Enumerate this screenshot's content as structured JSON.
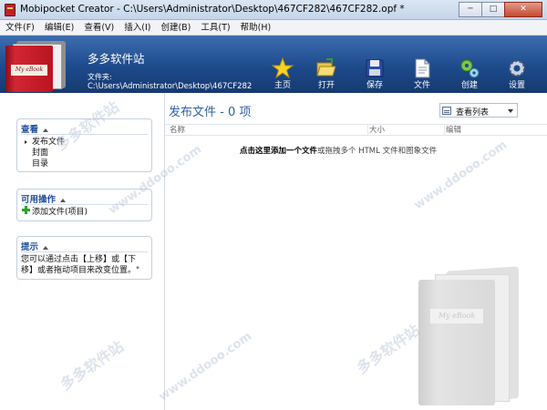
{
  "window": {
    "title": "Mobipocket Creator - C:\\Users\\Administrator\\Desktop\\467CF282\\467CF282.opf *",
    "buttons": {
      "minimize": "─",
      "maximize": "□",
      "close": "✕"
    }
  },
  "menubar": {
    "items": [
      {
        "label": "文件(F)"
      },
      {
        "label": "编辑(E)"
      },
      {
        "label": "查看(V)"
      },
      {
        "label": "插入(I)"
      },
      {
        "label": "创建(B)"
      },
      {
        "label": "工具(T)"
      },
      {
        "label": "帮助(H)"
      }
    ]
  },
  "header": {
    "cover_text": "My eBook",
    "project_name": "多多软件站",
    "folder_label": "文件夹:",
    "folder_path": "C:\\Users\\Administrator\\Desktop\\467CF282",
    "tools": [
      {
        "label": "主页",
        "icon": "star-icon",
        "color": "#f4d22a"
      },
      {
        "label": "打开",
        "icon": "open-folder-icon",
        "color": "#f1d05a"
      },
      {
        "label": "保存",
        "icon": "floppy-disk-icon",
        "color": "#2a4fa2"
      },
      {
        "label": "文件",
        "icon": "file-icon",
        "color": "#ffffff"
      },
      {
        "label": "创建",
        "icon": "build-gears-icon",
        "color": "#7fc744"
      },
      {
        "label": "设置",
        "icon": "settings-gear-icon",
        "color": "#c9d3e2"
      }
    ]
  },
  "sidebar": {
    "view_box": {
      "title": "查看",
      "items": [
        {
          "label": "发布文件",
          "current": true
        },
        {
          "label": "封面",
          "current": false
        },
        {
          "label": "目录",
          "current": false
        }
      ]
    },
    "actions_box": {
      "title": "可用操作",
      "items": [
        {
          "label": "添加文件(项目)",
          "icon": "plus-icon"
        }
      ]
    },
    "tips_box": {
      "title": "提示",
      "text": "您可以通过点击【上移】或【下移】或者拖动项目来改变位置。\""
    }
  },
  "main": {
    "title": "发布文件 - 0 项",
    "view_mode": "查看列表",
    "columns": [
      "名称",
      "大小",
      "编辑"
    ],
    "hint_link": "点击这里添加一个文件",
    "hint_rest": "或拖拽多个 HTML 文件和图象文件",
    "watermark_cover_text": "My eBook"
  },
  "watermarks": [
    "多多软件站",
    "www.ddooo.com",
    "多多软件站",
    "www.ddooo.com",
    "多多软件站",
    "www.ddooo.com"
  ],
  "colors": {
    "header_blue": "#1d4a8c",
    "accent_blue": "#2d5fa9",
    "book_red": "#c21f2b",
    "add_green": "#2fa12d"
  }
}
